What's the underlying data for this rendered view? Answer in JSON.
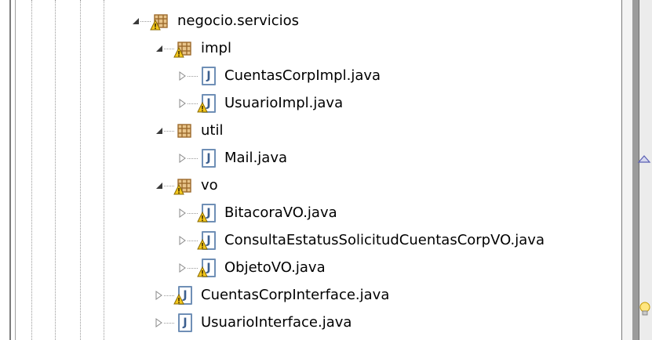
{
  "tree": {
    "nodes": [
      {
        "label": "negocio.servicios",
        "type": "package",
        "warning": true,
        "expanded": true,
        "depth": 0
      },
      {
        "label": "impl",
        "type": "package",
        "warning": true,
        "expanded": true,
        "depth": 1
      },
      {
        "label": "CuentasCorpImpl.java",
        "type": "java-file",
        "warning": false,
        "expanded": false,
        "depth": 2
      },
      {
        "label": "UsuarioImpl.java",
        "type": "java-file",
        "warning": true,
        "expanded": false,
        "depth": 2
      },
      {
        "label": "util",
        "type": "package",
        "warning": false,
        "expanded": true,
        "depth": 1
      },
      {
        "label": "Mail.java",
        "type": "java-file",
        "warning": false,
        "expanded": false,
        "depth": 2
      },
      {
        "label": "vo",
        "type": "package",
        "warning": true,
        "expanded": true,
        "depth": 1
      },
      {
        "label": "BitacoraVO.java",
        "type": "java-file",
        "warning": true,
        "expanded": false,
        "depth": 2
      },
      {
        "label": "ConsultaEstatusSolicitudCuentasCorpVO.java",
        "type": "java-file",
        "warning": true,
        "expanded": false,
        "depth": 2
      },
      {
        "label": "ObjetoVO.java",
        "type": "java-file",
        "warning": true,
        "expanded": false,
        "depth": 2
      },
      {
        "label": "CuentasCorpInterface.java",
        "type": "java-file",
        "warning": true,
        "expanded": false,
        "depth": 1
      },
      {
        "label": "UsuarioInterface.java",
        "type": "java-file",
        "warning": false,
        "expanded": false,
        "depth": 1
      }
    ]
  },
  "icons": {
    "package": "package-icon",
    "java-file": "java-file-icon",
    "warning": "warning-overlay-icon",
    "expanded": "expanded-twisty-icon",
    "collapsed": "collapsed-twisty-icon",
    "ruler": "overview-ruler-marker-icon",
    "lightbulb": "quick-fix-lightbulb-icon"
  },
  "colors": {
    "package_brown": "#9c6a2c",
    "package_fill": "#e8c48a",
    "warning_yellow": "#f4c81c",
    "java_blue": "#3c5f8f",
    "guide_dots": "#9a9a9a"
  }
}
